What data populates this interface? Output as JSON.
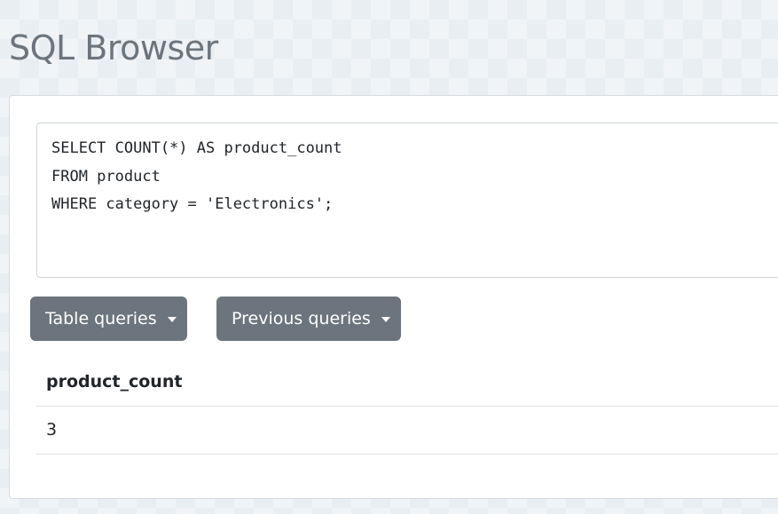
{
  "header": {
    "title": "SQL Browser"
  },
  "editor": {
    "lines": [
      "SELECT COUNT(*) AS product_count",
      "FROM product",
      "WHERE category = 'Electronics';"
    ]
  },
  "toolbar": {
    "table_queries_label": "Table queries",
    "previous_queries_label": "Previous queries"
  },
  "results": {
    "columns": [
      "product_count"
    ],
    "rows": [
      [
        "3"
      ]
    ]
  },
  "colors": {
    "button_bg": "#6c757d",
    "title": "#6c757d",
    "card_bg": "#ffffff"
  },
  "icons": {
    "dropdown": "caret-down-icon"
  }
}
